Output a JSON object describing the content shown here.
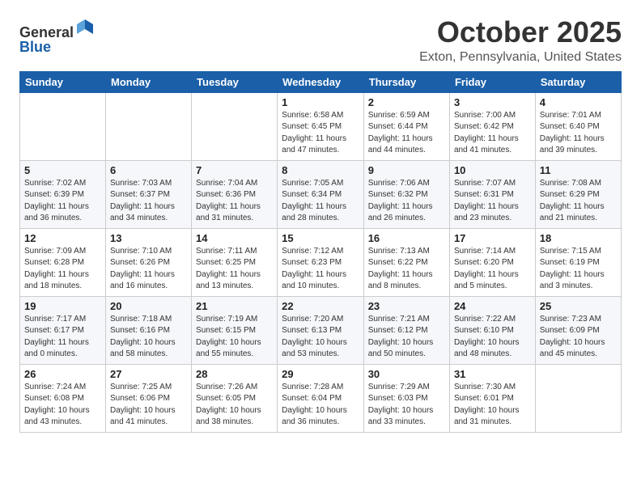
{
  "header": {
    "logo_line1": "General",
    "logo_line2": "Blue",
    "month": "October 2025",
    "location": "Exton, Pennsylvania, United States"
  },
  "weekdays": [
    "Sunday",
    "Monday",
    "Tuesday",
    "Wednesday",
    "Thursday",
    "Friday",
    "Saturday"
  ],
  "weeks": [
    [
      {
        "day": "",
        "info": ""
      },
      {
        "day": "",
        "info": ""
      },
      {
        "day": "",
        "info": ""
      },
      {
        "day": "1",
        "info": "Sunrise: 6:58 AM\nSunset: 6:45 PM\nDaylight: 11 hours\nand 47 minutes."
      },
      {
        "day": "2",
        "info": "Sunrise: 6:59 AM\nSunset: 6:44 PM\nDaylight: 11 hours\nand 44 minutes."
      },
      {
        "day": "3",
        "info": "Sunrise: 7:00 AM\nSunset: 6:42 PM\nDaylight: 11 hours\nand 41 minutes."
      },
      {
        "day": "4",
        "info": "Sunrise: 7:01 AM\nSunset: 6:40 PM\nDaylight: 11 hours\nand 39 minutes."
      }
    ],
    [
      {
        "day": "5",
        "info": "Sunrise: 7:02 AM\nSunset: 6:39 PM\nDaylight: 11 hours\nand 36 minutes."
      },
      {
        "day": "6",
        "info": "Sunrise: 7:03 AM\nSunset: 6:37 PM\nDaylight: 11 hours\nand 34 minutes."
      },
      {
        "day": "7",
        "info": "Sunrise: 7:04 AM\nSunset: 6:36 PM\nDaylight: 11 hours\nand 31 minutes."
      },
      {
        "day": "8",
        "info": "Sunrise: 7:05 AM\nSunset: 6:34 PM\nDaylight: 11 hours\nand 28 minutes."
      },
      {
        "day": "9",
        "info": "Sunrise: 7:06 AM\nSunset: 6:32 PM\nDaylight: 11 hours\nand 26 minutes."
      },
      {
        "day": "10",
        "info": "Sunrise: 7:07 AM\nSunset: 6:31 PM\nDaylight: 11 hours\nand 23 minutes."
      },
      {
        "day": "11",
        "info": "Sunrise: 7:08 AM\nSunset: 6:29 PM\nDaylight: 11 hours\nand 21 minutes."
      }
    ],
    [
      {
        "day": "12",
        "info": "Sunrise: 7:09 AM\nSunset: 6:28 PM\nDaylight: 11 hours\nand 18 minutes."
      },
      {
        "day": "13",
        "info": "Sunrise: 7:10 AM\nSunset: 6:26 PM\nDaylight: 11 hours\nand 16 minutes."
      },
      {
        "day": "14",
        "info": "Sunrise: 7:11 AM\nSunset: 6:25 PM\nDaylight: 11 hours\nand 13 minutes."
      },
      {
        "day": "15",
        "info": "Sunrise: 7:12 AM\nSunset: 6:23 PM\nDaylight: 11 hours\nand 10 minutes."
      },
      {
        "day": "16",
        "info": "Sunrise: 7:13 AM\nSunset: 6:22 PM\nDaylight: 11 hours\nand 8 minutes."
      },
      {
        "day": "17",
        "info": "Sunrise: 7:14 AM\nSunset: 6:20 PM\nDaylight: 11 hours\nand 5 minutes."
      },
      {
        "day": "18",
        "info": "Sunrise: 7:15 AM\nSunset: 6:19 PM\nDaylight: 11 hours\nand 3 minutes."
      }
    ],
    [
      {
        "day": "19",
        "info": "Sunrise: 7:17 AM\nSunset: 6:17 PM\nDaylight: 11 hours\nand 0 minutes."
      },
      {
        "day": "20",
        "info": "Sunrise: 7:18 AM\nSunset: 6:16 PM\nDaylight: 10 hours\nand 58 minutes."
      },
      {
        "day": "21",
        "info": "Sunrise: 7:19 AM\nSunset: 6:15 PM\nDaylight: 10 hours\nand 55 minutes."
      },
      {
        "day": "22",
        "info": "Sunrise: 7:20 AM\nSunset: 6:13 PM\nDaylight: 10 hours\nand 53 minutes."
      },
      {
        "day": "23",
        "info": "Sunrise: 7:21 AM\nSunset: 6:12 PM\nDaylight: 10 hours\nand 50 minutes."
      },
      {
        "day": "24",
        "info": "Sunrise: 7:22 AM\nSunset: 6:10 PM\nDaylight: 10 hours\nand 48 minutes."
      },
      {
        "day": "25",
        "info": "Sunrise: 7:23 AM\nSunset: 6:09 PM\nDaylight: 10 hours\nand 45 minutes."
      }
    ],
    [
      {
        "day": "26",
        "info": "Sunrise: 7:24 AM\nSunset: 6:08 PM\nDaylight: 10 hours\nand 43 minutes."
      },
      {
        "day": "27",
        "info": "Sunrise: 7:25 AM\nSunset: 6:06 PM\nDaylight: 10 hours\nand 41 minutes."
      },
      {
        "day": "28",
        "info": "Sunrise: 7:26 AM\nSunset: 6:05 PM\nDaylight: 10 hours\nand 38 minutes."
      },
      {
        "day": "29",
        "info": "Sunrise: 7:28 AM\nSunset: 6:04 PM\nDaylight: 10 hours\nand 36 minutes."
      },
      {
        "day": "30",
        "info": "Sunrise: 7:29 AM\nSunset: 6:03 PM\nDaylight: 10 hours\nand 33 minutes."
      },
      {
        "day": "31",
        "info": "Sunrise: 7:30 AM\nSunset: 6:01 PM\nDaylight: 10 hours\nand 31 minutes."
      },
      {
        "day": "",
        "info": ""
      }
    ]
  ]
}
